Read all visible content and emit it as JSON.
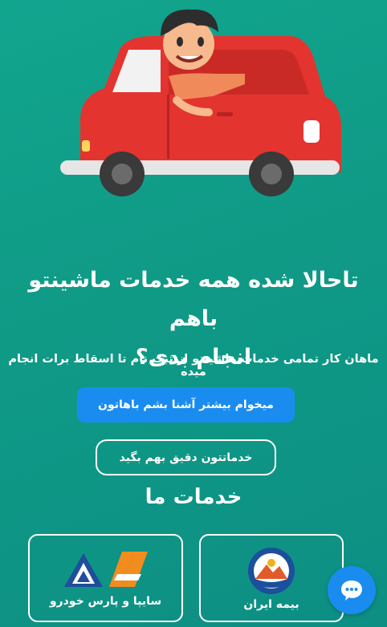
{
  "hero": {
    "headline_line1": "تاحالا شده همه خدمات ماشینتو باهم",
    "headline_line2": "انجام بدی؟",
    "subtitle": "ماهان کار تمامی خدمات ماشینتو از ثبت نام تا اسقاط برات انجام میده"
  },
  "buttons": {
    "primary_label": "میخوام بیشتر آشنا بشم باهاتون",
    "secondary_label": "خدماتتون دقیق بهم بگید"
  },
  "services": {
    "title": "خدمات ما",
    "items": [
      {
        "label": "بیمه ایران",
        "icon": "iran-insurance-logo"
      },
      {
        "label": "سایپا و پارس خودرو",
        "icon": "saipa-pars-khodro-logo"
      }
    ]
  },
  "colors": {
    "background": "#0f9a86",
    "primary_button": "#1a8cf0",
    "car_red": "#e3342f"
  }
}
